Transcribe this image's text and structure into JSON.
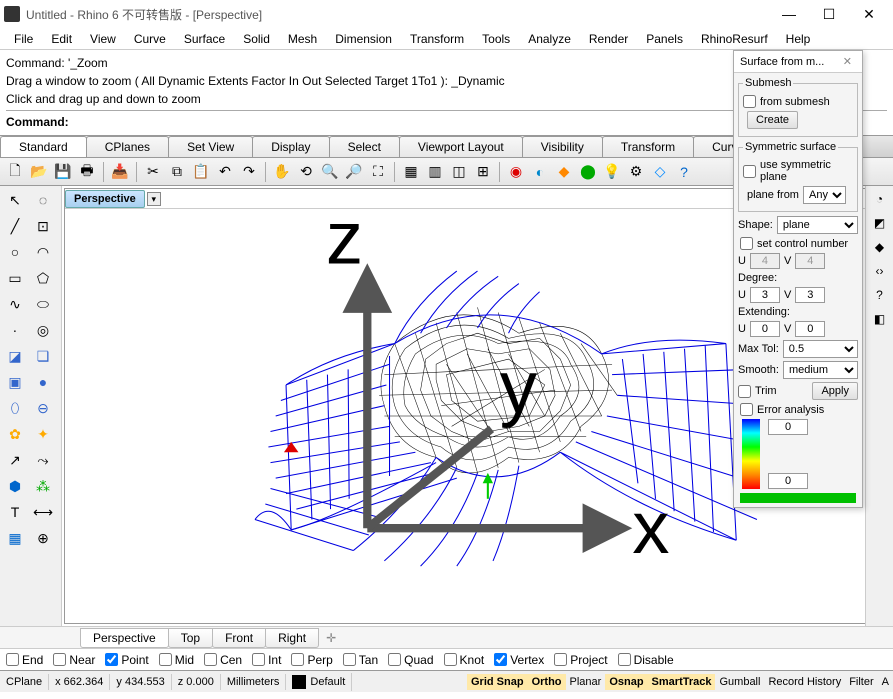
{
  "title": "Untitled - Rhino 6 不可转售版 - [Perspective]",
  "menu": [
    "File",
    "Edit",
    "View",
    "Curve",
    "Surface",
    "Solid",
    "Mesh",
    "Dimension",
    "Transform",
    "Tools",
    "Analyze",
    "Render",
    "Panels",
    "RhinoResurf",
    "Help"
  ],
  "command_lines": [
    "Command: '_Zoom",
    "Drag a window to zoom ( All  Dynamic  Extents  Factor  In  Out  Selected  Target  1To1 ): _Dynamic",
    "Click and drag up and down to zoom"
  ],
  "command_prompt": "Command:",
  "tabs": [
    "Standard",
    "CPlanes",
    "Set View",
    "Display",
    "Select",
    "Viewport Layout",
    "Visibility",
    "Transform",
    "Curve Tools"
  ],
  "viewport_label": "Perspective",
  "view_tabs": [
    "Perspective",
    "Top",
    "Front",
    "Right"
  ],
  "osnap": [
    {
      "label": "End",
      "on": false
    },
    {
      "label": "Near",
      "on": false
    },
    {
      "label": "Point",
      "on": true
    },
    {
      "label": "Mid",
      "on": false
    },
    {
      "label": "Cen",
      "on": false
    },
    {
      "label": "Int",
      "on": false
    },
    {
      "label": "Perp",
      "on": false
    },
    {
      "label": "Tan",
      "on": false
    },
    {
      "label": "Quad",
      "on": false
    },
    {
      "label": "Knot",
      "on": false
    },
    {
      "label": "Vertex",
      "on": true
    },
    {
      "label": "Project",
      "on": false
    },
    {
      "label": "Disable",
      "on": false
    }
  ],
  "status": {
    "cplane": "CPlane",
    "x": "x 662.364",
    "y": "y 434.553",
    "z": "z 0.000",
    "units": "Millimeters",
    "layer": "Default",
    "toggles": [
      {
        "label": "Grid Snap",
        "on": true
      },
      {
        "label": "Ortho",
        "on": true
      },
      {
        "label": "Planar",
        "on": false
      },
      {
        "label": "Osnap",
        "on": true
      },
      {
        "label": "SmartTrack",
        "on": true
      },
      {
        "label": "Gumball",
        "on": false
      },
      {
        "label": "Record History",
        "on": false
      },
      {
        "label": "Filter",
        "on": false
      },
      {
        "label": "A",
        "on": false
      }
    ]
  },
  "panel": {
    "title": "Surface from m...",
    "submesh_legend": "Submesh",
    "from_submesh": "from submesh",
    "create": "Create",
    "symmetric_legend": "Symmetric surface",
    "use_symmetric": "use symmetric plane",
    "plane_from": "plane from",
    "plane_from_val": "Any",
    "shape": "Shape:",
    "shape_val": "plane",
    "set_ctrl": "set control number",
    "u": "U",
    "v": "V",
    "u1": "4",
    "v1": "4",
    "degree": "Degree:",
    "u2": "3",
    "v2": "3",
    "extending": "Extending:",
    "u3": "0",
    "v3": "0",
    "maxtol": "Max Tol:",
    "maxtol_val": "0.5",
    "smooth": "Smooth:",
    "smooth_val": "medium",
    "trim": "Trim",
    "apply": "Apply",
    "error": "Error analysis",
    "err_hi": "0",
    "err_lo": "0"
  },
  "axis": {
    "x": "x",
    "y": "y",
    "z": "z"
  }
}
